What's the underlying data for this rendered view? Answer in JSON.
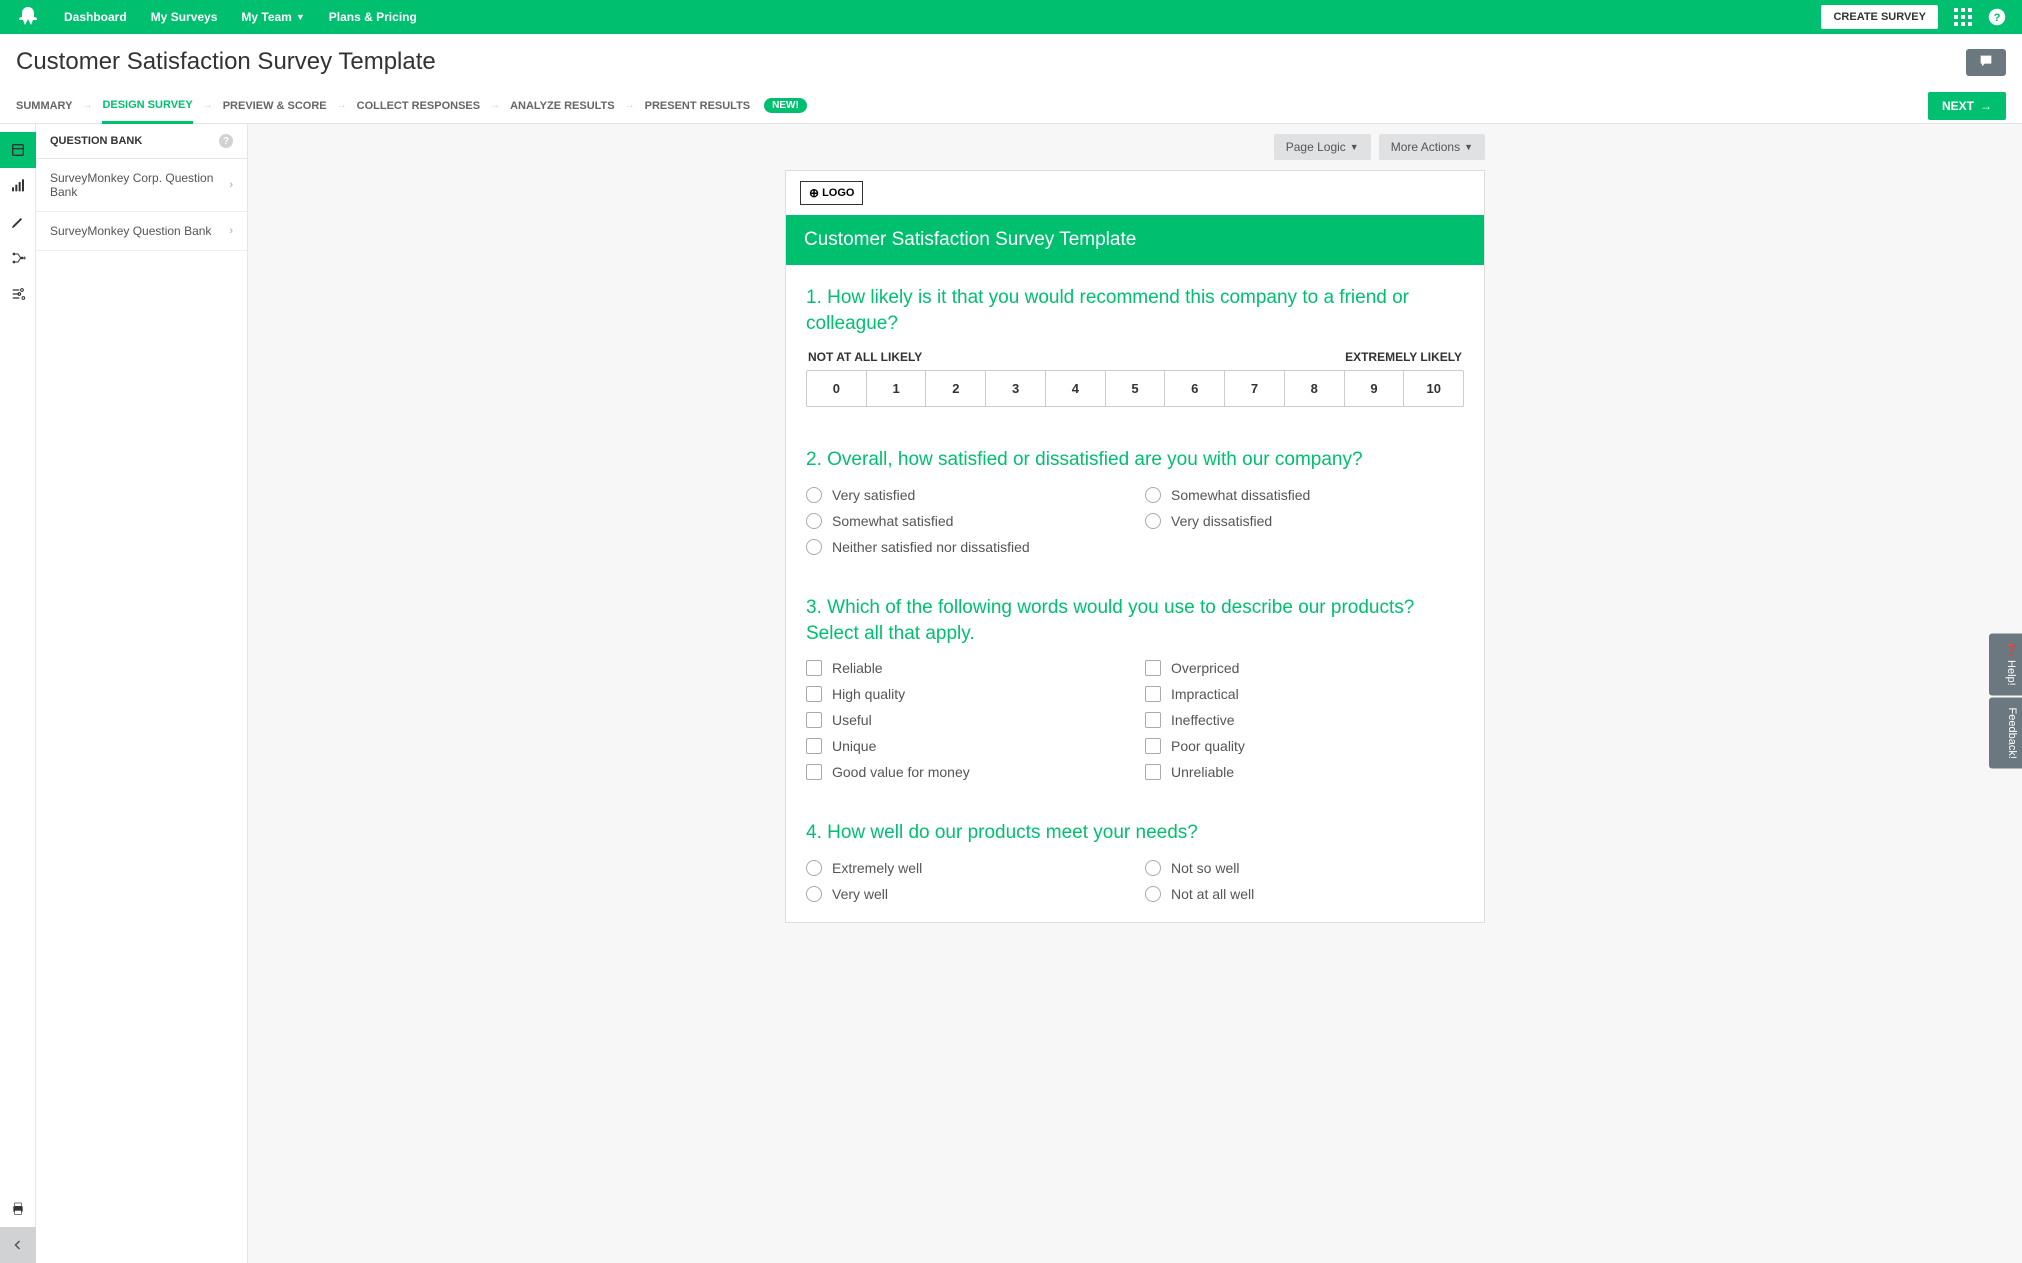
{
  "topnav": {
    "items": [
      "Dashboard",
      "My Surveys",
      "My Team",
      "Plans & Pricing"
    ],
    "create_label": "CREATE SURVEY"
  },
  "page_title": "Customer Satisfaction Survey Template",
  "steps": {
    "items": [
      "SUMMARY",
      "DESIGN SURVEY",
      "PREVIEW & SCORE",
      "COLLECT RESPONSES",
      "ANALYZE RESULTS",
      "PRESENT RESULTS"
    ],
    "badge": "NEW!",
    "next_label": "NEXT"
  },
  "sidebar": {
    "header": "QUESTION BANK",
    "items": [
      "SurveyMonkey Corp. Question Bank",
      "SurveyMonkey Question Bank"
    ]
  },
  "canvas_toolbar": {
    "page_logic": "Page Logic",
    "more_actions": "More Actions"
  },
  "logo_button": "LOGO",
  "survey_title": "Customer Satisfaction Survey Template",
  "questions": {
    "q1": {
      "num": "1.",
      "text": "How likely is it that you would recommend this company to a friend or colleague?",
      "label_low": "NOT AT ALL LIKELY",
      "label_high": "EXTREMELY LIKELY",
      "scale": [
        "0",
        "1",
        "2",
        "3",
        "4",
        "5",
        "6",
        "7",
        "8",
        "9",
        "10"
      ]
    },
    "q2": {
      "num": "2.",
      "text": "Overall, how satisfied or dissatisfied are you with our company?",
      "options_col1": [
        "Very satisfied",
        "Somewhat satisfied",
        "Neither satisfied nor dissatisfied"
      ],
      "options_col2": [
        "Somewhat dissatisfied",
        "Very dissatisfied"
      ]
    },
    "q3": {
      "num": "3.",
      "text": "Which of the following words would you use to describe our products? Select all that apply.",
      "options_col1": [
        "Reliable",
        "High quality",
        "Useful",
        "Unique",
        "Good value for money"
      ],
      "options_col2": [
        "Overpriced",
        "Impractical",
        "Ineffective",
        "Poor quality",
        "Unreliable"
      ]
    },
    "q4": {
      "num": "4.",
      "text": "How well do our products meet your needs?",
      "options_col1": [
        "Extremely well",
        "Very well"
      ],
      "options_col2": [
        "Not so well",
        "Not at all well"
      ]
    }
  },
  "feedback": {
    "help": "Help!",
    "feedback": "Feedback!"
  }
}
